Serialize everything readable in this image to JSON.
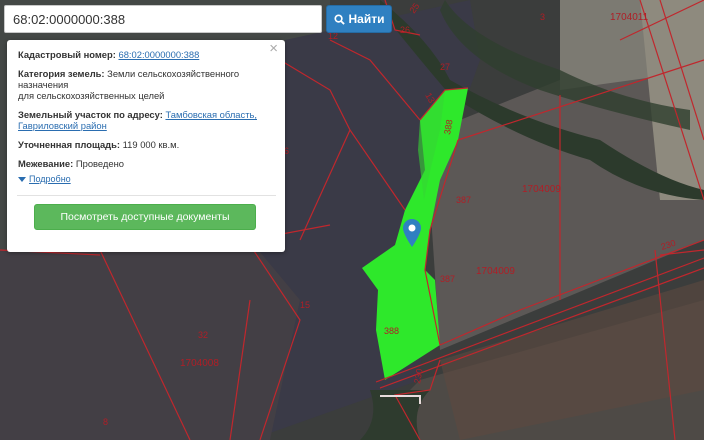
{
  "search": {
    "value": "68:02:0000000:388",
    "button_label": "Найти"
  },
  "popup": {
    "cadastral_label": "Кадастровый номер:",
    "cadastral_value": "68:02:0000000:388",
    "category_label": "Категория земель:",
    "category_line1": "Земли сельскохозяйственного",
    "category_line2": "назначения",
    "category_line3": "для сельскохозяйственных целей",
    "address_label": "Земельный участок по адресу:",
    "address_line1": "Тамбовская область,",
    "address_line2": "Гавриловский район",
    "area_label": "Уточненная площадь:",
    "area_value": "119 000 кв.м.",
    "survey_label": "Межевание:",
    "survey_value": "Проведено",
    "more_label": "Подробно",
    "docs_button_label": "Посмотреть доступные документы",
    "close_symbol": "×"
  },
  "map": {
    "labels": {
      "l25": "25",
      "l26": "26",
      "l3": "3",
      "l1704011": "1704011",
      "l12": "12",
      "l27": "27",
      "l13": "13",
      "l388a": "388",
      "l6": "6",
      "l387a": "387",
      "l1704009a": "1704009",
      "l230a": "230",
      "l387b": "387",
      "l1704009b": "1704009",
      "l15": "15",
      "l32": "32",
      "l388b": "388",
      "l1704008": "1704008",
      "l230b": "230",
      "l8": "8"
    },
    "colors": {
      "parcel_fill": "#2ee82b",
      "boundary": "#c0272d",
      "marker": "#2f80c1"
    }
  }
}
